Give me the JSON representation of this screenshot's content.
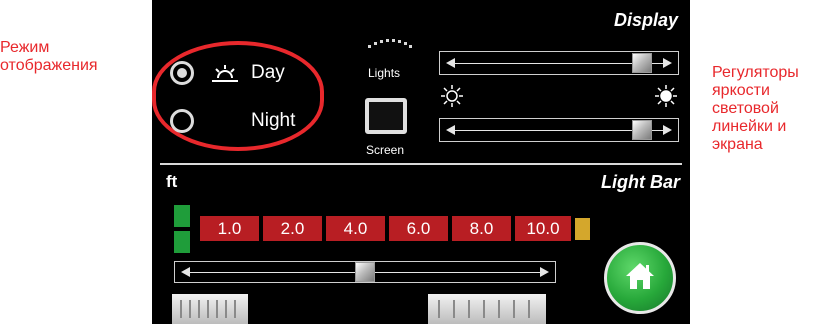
{
  "annotations": {
    "left": "Режим отображения",
    "right": "Регуляторы яркости световой линейки и экрана"
  },
  "display": {
    "title": "Display",
    "mode": {
      "day_label": "Day",
      "night_label": "Night",
      "selected": "day"
    },
    "lights_label": "Lights",
    "screen_label": "Screen",
    "lights_brightness_fraction": 0.92,
    "screen_brightness_fraction": 0.92
  },
  "light_bar": {
    "title": "Light Bar",
    "unit_label": "ft",
    "distances": [
      "1.0",
      "2.0",
      "4.0",
      "6.0",
      "8.0",
      "10.0"
    ],
    "slider_fraction": 0.5
  },
  "colors": {
    "annotation": "#e8282c",
    "distance_box": "#b81e23",
    "green_block": "#1f9d3a",
    "yellow_block": "#d4a72c",
    "home_button": "#27a83a"
  },
  "icons": [
    "sunrise-icon",
    "moon-icon",
    "lights-icon",
    "screen-icon",
    "sun-low-icon",
    "sun-high-icon",
    "home-icon"
  ]
}
